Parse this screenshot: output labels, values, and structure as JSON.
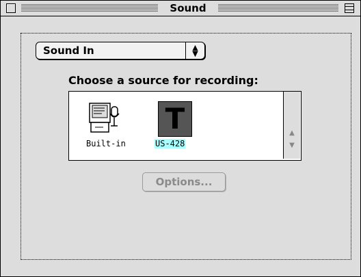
{
  "window": {
    "title": "Sound"
  },
  "section_popup": {
    "selected": "Sound In",
    "arrows_icon": "up-down-arrows-icon"
  },
  "recording": {
    "heading": "Choose a source for recording:",
    "sources": [
      {
        "label": "Built-in",
        "icon": "computer-microphone-icon",
        "selected": false
      },
      {
        "label": "US-428",
        "icon": "tascam-t-icon",
        "selected": true
      }
    ],
    "selection_color": "#a8ffff"
  },
  "options_button": {
    "label": "Options...",
    "enabled": false
  }
}
